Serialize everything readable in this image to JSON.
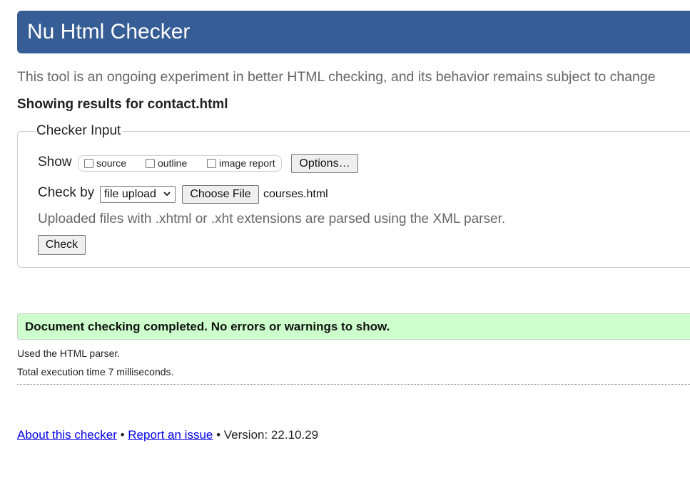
{
  "header": {
    "title": "Nu Html Checker"
  },
  "tagline": "This tool is an ongoing experiment in better HTML checking, and its behavior remains subject to change",
  "results_heading": "Showing results for contact.html",
  "checker_input": {
    "legend": "Checker Input",
    "show_label": "Show",
    "checkboxes": [
      {
        "label": "source",
        "checked": false
      },
      {
        "label": "outline",
        "checked": false
      },
      {
        "label": "image report",
        "checked": false
      }
    ],
    "options_button": "Options…",
    "check_by_label": "Check by",
    "method_selected": "file upload",
    "choose_file_button": "Choose File",
    "file_name": "courses.html",
    "xml_note": "Uploaded files with .xhtml or .xht extensions are parsed using the XML parser.",
    "check_button": "Check"
  },
  "result": {
    "success_message": "Document checking completed. No errors or warnings to show.",
    "parser_note": "Used the HTML parser.",
    "execution_time": "Total execution time 7 milliseconds."
  },
  "footer": {
    "about_link": "About this checker",
    "separator": "•",
    "report_link": "Report an issue",
    "version_text": "Version: 22.10.29"
  },
  "colors": {
    "banner": "#365d95",
    "success_bg": "#ccffcc",
    "link": "#0000ee",
    "muted_text": "#666666"
  }
}
